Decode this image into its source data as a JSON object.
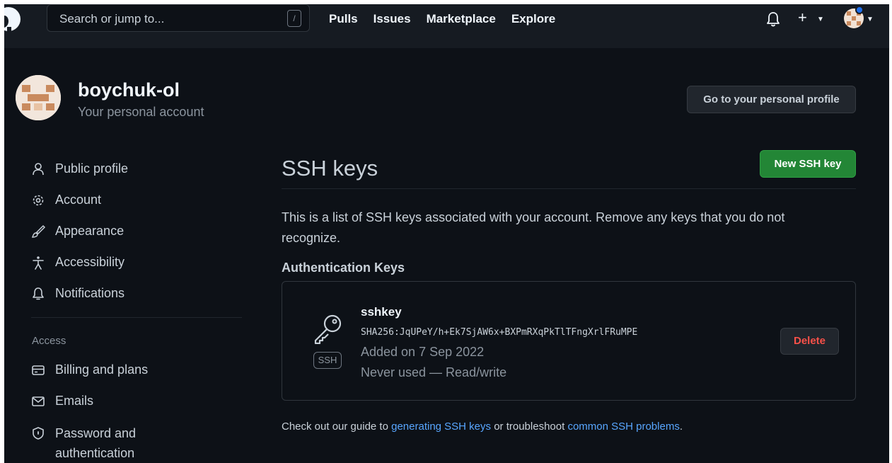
{
  "header": {
    "search_placeholder": "Search or jump to...",
    "search_shortcut": "/",
    "nav": [
      "Pulls",
      "Issues",
      "Marketplace",
      "Explore"
    ],
    "plus_label": "+"
  },
  "account": {
    "name": "boychuk-ol",
    "subtitle": "Your personal account",
    "profile_button": "Go to your personal profile"
  },
  "sidebar": {
    "items": [
      {
        "label": "Public profile",
        "icon": "person-icon"
      },
      {
        "label": "Account",
        "icon": "gear-icon"
      },
      {
        "label": "Appearance",
        "icon": "paintbrush-icon"
      },
      {
        "label": "Accessibility",
        "icon": "accessibility-icon"
      },
      {
        "label": "Notifications",
        "icon": "bell-icon"
      }
    ],
    "access_heading": "Access",
    "access_items": [
      {
        "label": "Billing and plans",
        "icon": "credit-card-icon"
      },
      {
        "label": "Emails",
        "icon": "mail-icon"
      },
      {
        "label_line1": "Password and",
        "label_line2": "authentication",
        "icon": "shield-icon"
      }
    ]
  },
  "main": {
    "title": "SSH keys",
    "new_button": "New SSH key",
    "description": "This is a list of SSH keys associated with your account. Remove any keys that you do not recognize.",
    "section_heading": "Authentication Keys",
    "key": {
      "name": "sshkey",
      "fingerprint": "SHA256:JqUPeY/h+Ek7SjAW6x+BXPmRXqPkTlTFngXrlFRuMPE",
      "added": "Added on 7 Sep 2022",
      "usage": "Never used — Read/write",
      "badge": "SSH",
      "delete_label": "Delete"
    },
    "footer": {
      "prefix": "Check out our guide to ",
      "link1": "generating SSH keys",
      "middle": " or troubleshoot ",
      "link2": "common SSH problems",
      "suffix": "."
    }
  },
  "colors": {
    "background": "#0d1117",
    "header": "#161b22",
    "accent_green": "#238636",
    "danger": "#f85149",
    "link": "#58a6ff"
  }
}
